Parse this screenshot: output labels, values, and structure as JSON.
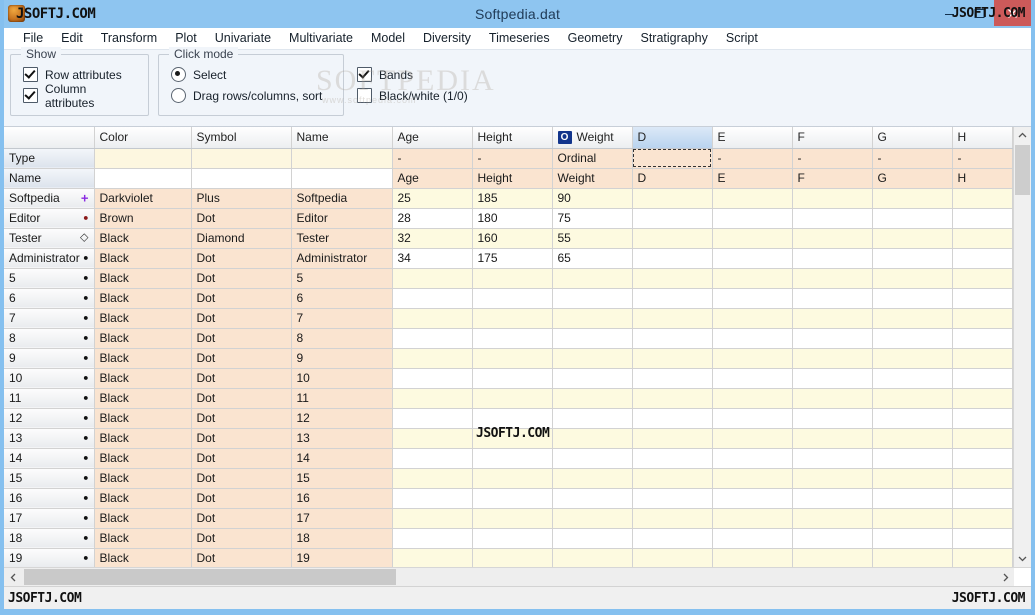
{
  "window": {
    "title": "Softpedia.dat",
    "app_icon": "app-icon",
    "watermark_title_left": "JSOFTJ.COM",
    "watermark_title_right": "JSOFTJ.COM",
    "controls": {
      "minimize": "minimize-icon",
      "maximize": "maximize-icon",
      "close": "close-icon"
    }
  },
  "menubar": {
    "items": [
      "File",
      "Edit",
      "Transform",
      "Plot",
      "Univariate",
      "Multivariate",
      "Model",
      "Diversity",
      "Timeseries",
      "Geometry",
      "Stratigraphy",
      "Script"
    ]
  },
  "options": {
    "show": {
      "title": "Show",
      "row_attributes": {
        "label": "Row attributes",
        "checked": true
      },
      "column_attributes": {
        "label": "Column attributes",
        "checked": true
      }
    },
    "click_mode": {
      "title": "Click mode",
      "select": {
        "label": "Select",
        "selected": true
      },
      "drag": {
        "label": "Drag rows/columns, sort",
        "selected": false
      }
    },
    "bands": {
      "label": "Bands",
      "checked": true
    },
    "black_white": {
      "label": "Black/white (1/0)",
      "checked": false
    },
    "watermark": "SOFTPEDIA",
    "watermark_sub": "www.softpedia.com"
  },
  "sheet": {
    "columns": [
      "",
      "Color",
      "Symbol",
      "Name",
      "Age",
      "Height",
      "Weight",
      "D",
      "E",
      "F",
      "G",
      "H"
    ],
    "selected_column": "D",
    "weight_badge": "O",
    "attribute_rows": [
      {
        "header": "Type",
        "cells": [
          "",
          "",
          "",
          "-",
          "-",
          "Ordinal",
          "",
          "-",
          "-",
          "-",
          "-"
        ]
      },
      {
        "header": "Name",
        "cells": [
          "",
          "",
          "",
          "Age",
          "Height",
          "Weight",
          "D",
          "E",
          "F",
          "G",
          "H"
        ]
      }
    ],
    "data_rows": [
      {
        "header": "Softpedia",
        "marker": "plus",
        "marker_color": "#8a2be2",
        "cells": [
          "Darkviolet",
          "Plus",
          "Softpedia",
          "25",
          "185",
          "90",
          "",
          "",
          "",
          "",
          ""
        ]
      },
      {
        "header": "Editor",
        "marker": "dot",
        "marker_color": "#8b1a1a",
        "cells": [
          "Brown",
          "Dot",
          "Editor",
          "28",
          "180",
          "75",
          "",
          "",
          "",
          "",
          ""
        ]
      },
      {
        "header": "Tester",
        "marker": "diamond",
        "marker_color": "#333333",
        "cells": [
          "Black",
          "Diamond",
          "Tester",
          "32",
          "160",
          "55",
          "",
          "",
          "",
          "",
          ""
        ]
      },
      {
        "header": "Administrator",
        "marker": "dot",
        "marker_color": "#111111",
        "cells": [
          "Black",
          "Dot",
          "Administrator",
          "34",
          "175",
          "65",
          "",
          "",
          "",
          "",
          ""
        ]
      },
      {
        "header": "5",
        "marker": "dot",
        "marker_color": "#111111",
        "cells": [
          "Black",
          "Dot",
          "5",
          "",
          "",
          "",
          "",
          "",
          "",
          "",
          ""
        ]
      },
      {
        "header": "6",
        "marker": "dot",
        "marker_color": "#111111",
        "cells": [
          "Black",
          "Dot",
          "6",
          "",
          "",
          "",
          "",
          "",
          "",
          "",
          ""
        ]
      },
      {
        "header": "7",
        "marker": "dot",
        "marker_color": "#111111",
        "cells": [
          "Black",
          "Dot",
          "7",
          "",
          "",
          "",
          "",
          "",
          "",
          "",
          ""
        ]
      },
      {
        "header": "8",
        "marker": "dot",
        "marker_color": "#111111",
        "cells": [
          "Black",
          "Dot",
          "8",
          "",
          "",
          "",
          "",
          "",
          "",
          "",
          ""
        ]
      },
      {
        "header": "9",
        "marker": "dot",
        "marker_color": "#111111",
        "cells": [
          "Black",
          "Dot",
          "9",
          "",
          "",
          "",
          "",
          "",
          "",
          "",
          ""
        ]
      },
      {
        "header": "10",
        "marker": "dot",
        "marker_color": "#111111",
        "cells": [
          "Black",
          "Dot",
          "10",
          "",
          "",
          "",
          "",
          "",
          "",
          "",
          ""
        ]
      },
      {
        "header": "11",
        "marker": "dot",
        "marker_color": "#111111",
        "cells": [
          "Black",
          "Dot",
          "11",
          "",
          "",
          "",
          "",
          "",
          "",
          "",
          ""
        ]
      },
      {
        "header": "12",
        "marker": "dot",
        "marker_color": "#111111",
        "cells": [
          "Black",
          "Dot",
          "12",
          "",
          "",
          "",
          "",
          "",
          "",
          "",
          ""
        ]
      },
      {
        "header": "13",
        "marker": "dot",
        "marker_color": "#111111",
        "cells": [
          "Black",
          "Dot",
          "13",
          "",
          "",
          "",
          "",
          "",
          "",
          "",
          ""
        ]
      },
      {
        "header": "14",
        "marker": "dot",
        "marker_color": "#111111",
        "cells": [
          "Black",
          "Dot",
          "14",
          "",
          "",
          "",
          "",
          "",
          "",
          "",
          ""
        ]
      },
      {
        "header": "15",
        "marker": "dot",
        "marker_color": "#111111",
        "cells": [
          "Black",
          "Dot",
          "15",
          "",
          "",
          "",
          "",
          "",
          "",
          "",
          ""
        ]
      },
      {
        "header": "16",
        "marker": "dot",
        "marker_color": "#111111",
        "cells": [
          "Black",
          "Dot",
          "16",
          "",
          "",
          "",
          "",
          "",
          "",
          "",
          ""
        ]
      },
      {
        "header": "17",
        "marker": "dot",
        "marker_color": "#111111",
        "cells": [
          "Black",
          "Dot",
          "17",
          "",
          "",
          "",
          "",
          "",
          "",
          "",
          ""
        ]
      },
      {
        "header": "18",
        "marker": "dot",
        "marker_color": "#111111",
        "cells": [
          "Black",
          "Dot",
          "18",
          "",
          "",
          "",
          "",
          "",
          "",
          "",
          ""
        ]
      },
      {
        "header": "19",
        "marker": "dot",
        "marker_color": "#111111",
        "cells": [
          "Black",
          "Dot",
          "19",
          "",
          "",
          "",
          "",
          "",
          "",
          "",
          ""
        ]
      }
    ],
    "watermark": "JSOFTJ.COM"
  },
  "statusbar": {
    "watermark_left": "JSOFTJ.COM",
    "watermark_right": "JSOFTJ.COM"
  }
}
